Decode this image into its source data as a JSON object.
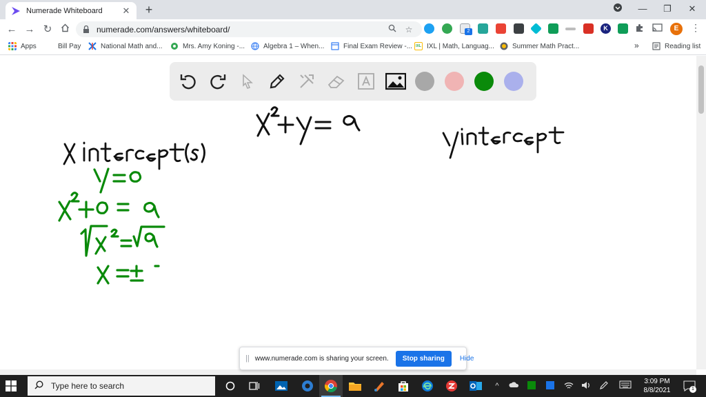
{
  "browser": {
    "tab_title": "Numerade Whiteboard",
    "tab_close": "✕",
    "new_tab": "+",
    "url": "numerade.com/answers/whiteboard/",
    "window_minimize": "—",
    "window_restore": "❐",
    "window_close": "✕",
    "profile_initial": "E",
    "extension_badge": "2"
  },
  "bookmarks": {
    "items": [
      {
        "label": "Apps",
        "color": "#4285f4"
      },
      {
        "label": "Bill Pay",
        "color": "#ffffff"
      },
      {
        "label": "National Math and...",
        "color": "#1a73e8"
      },
      {
        "label": "Mrs. Amy Koning -...",
        "color": "#34a853"
      },
      {
        "label": "Algebra 1 – When...",
        "color": "#4285f4"
      },
      {
        "label": "Final Exam Review -...",
        "color": "#4285f4"
      },
      {
        "label": "IXL | Math, Languag...",
        "color": "#fbbc04"
      },
      {
        "label": "Summer Math Pract...",
        "color": "#5f6368"
      }
    ],
    "more": "»",
    "reading_list": "Reading list"
  },
  "whiteboard": {
    "tools": [
      "undo-icon",
      "redo-icon",
      "pointer-icon",
      "pen-icon",
      "tools-icon",
      "eraser-icon",
      "text-icon",
      "image-icon"
    ],
    "colors": [
      "#a8a8a8",
      "#f0b4b4",
      "#0a8a0a",
      "#aab0ec"
    ],
    "selected_color": "#0a8a0a"
  },
  "sharing": {
    "message": "www.numerade.com is sharing your screen.",
    "stop": "Stop sharing",
    "hide": "Hide"
  },
  "taskbar": {
    "search_placeholder": "Type here to search",
    "time": "3:09 PM",
    "date": "8/8/2021",
    "notification_count": "1"
  }
}
